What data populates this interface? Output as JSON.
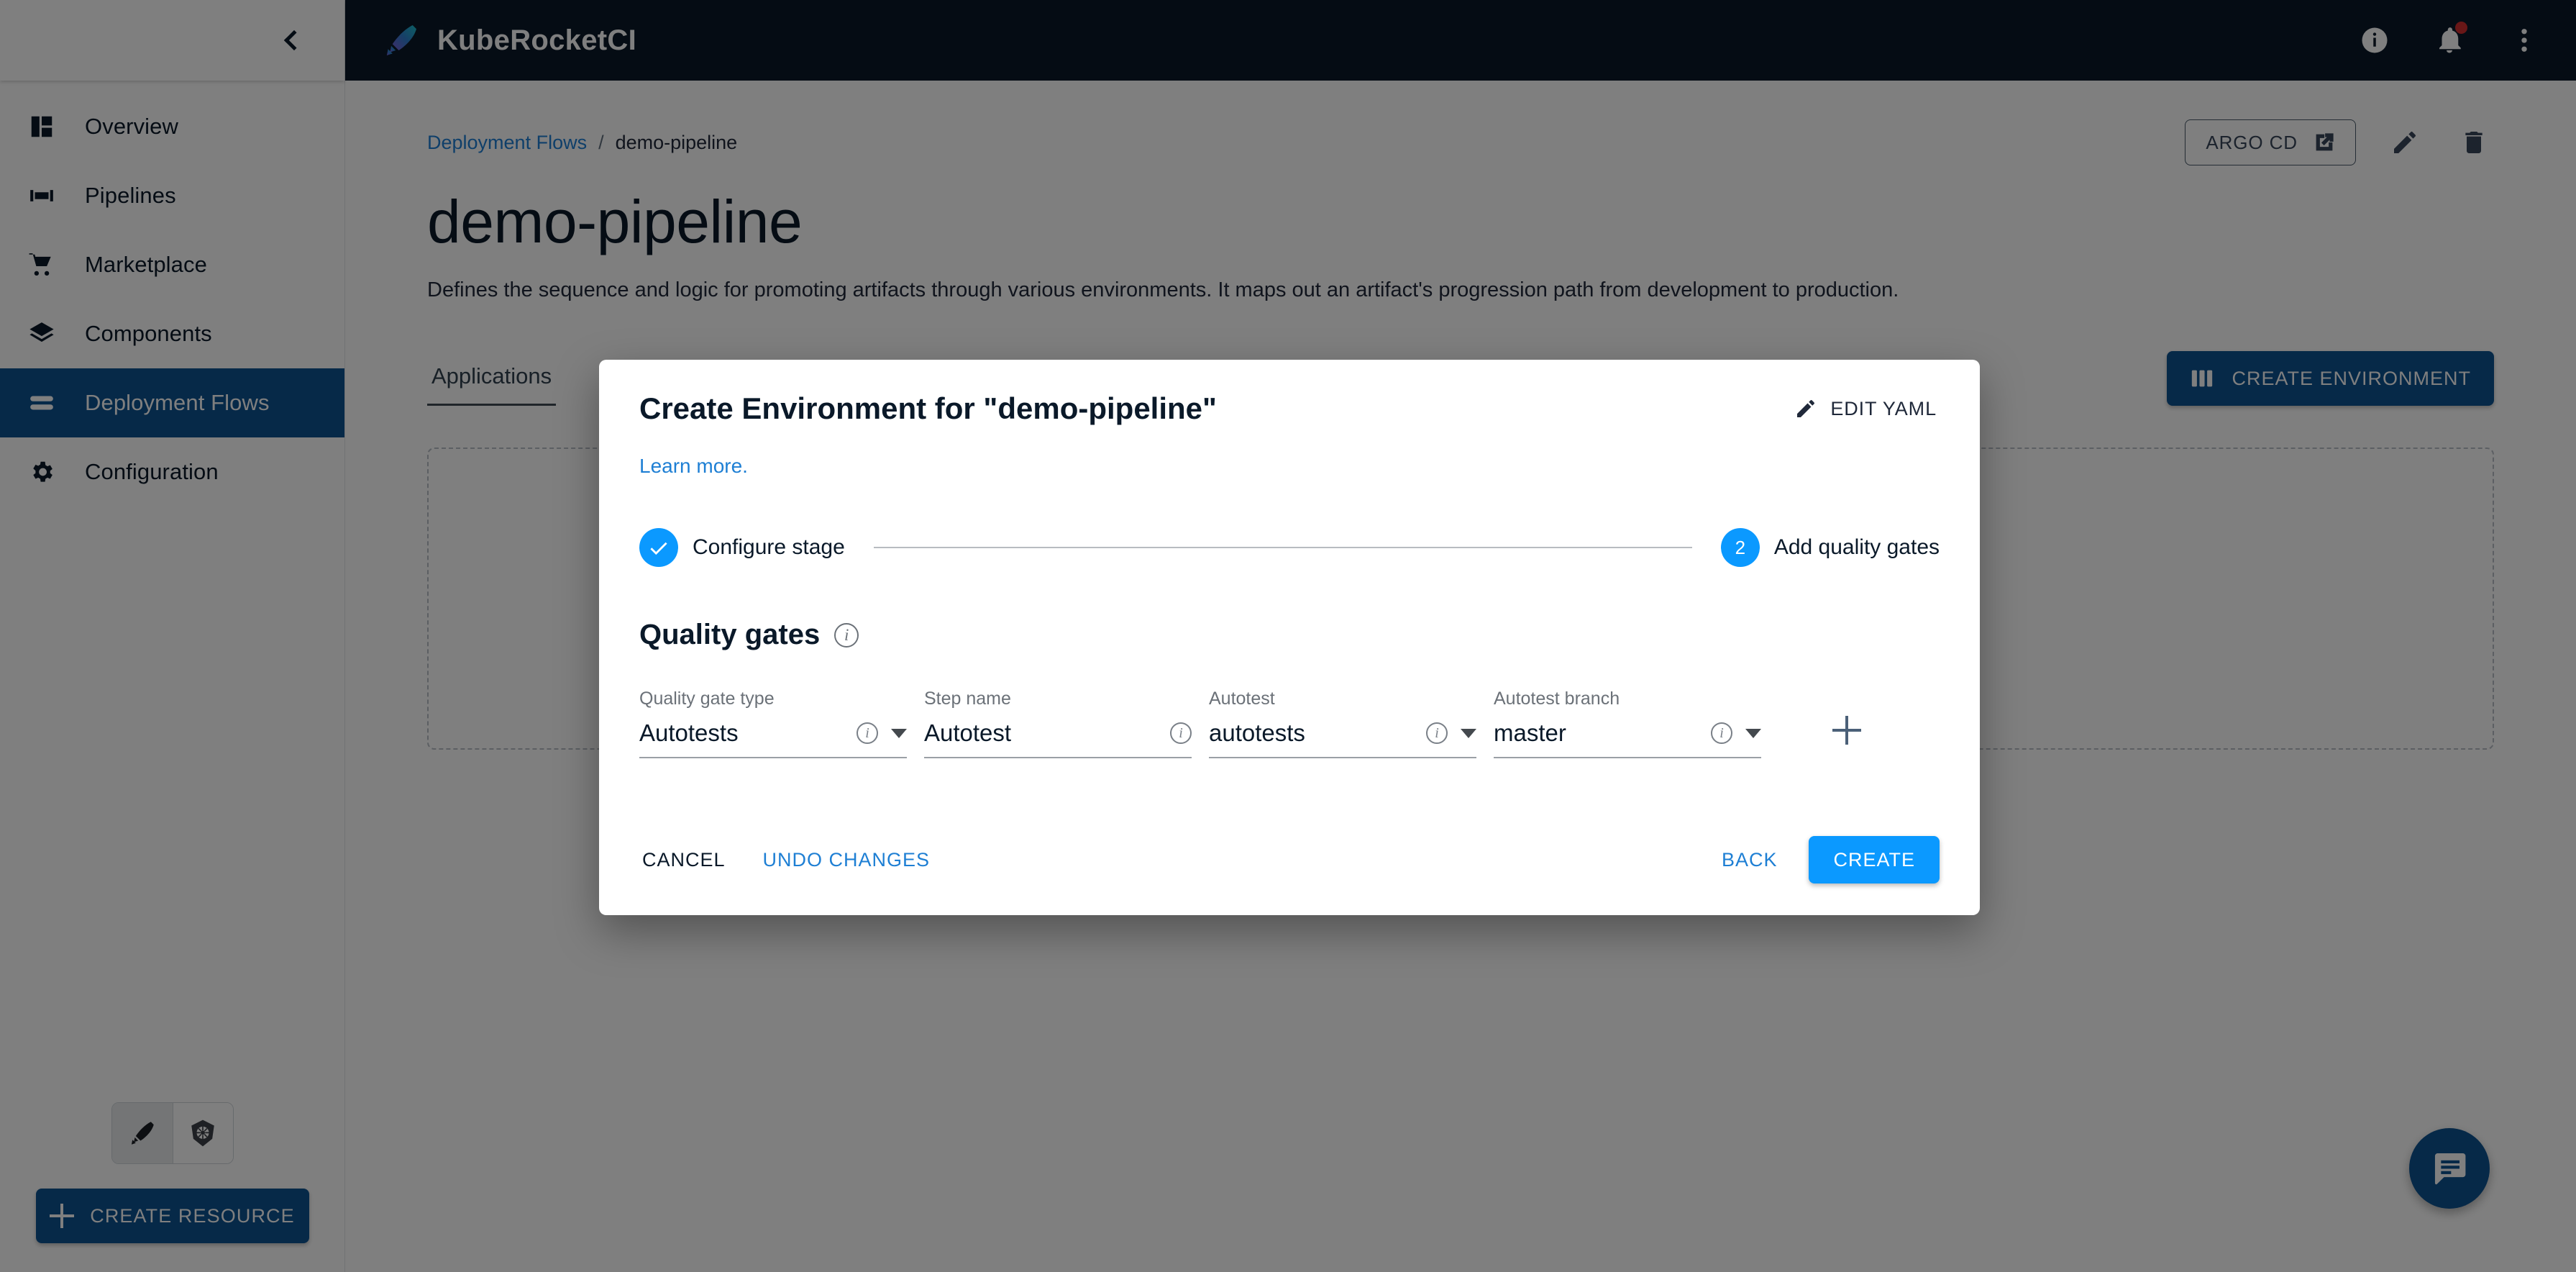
{
  "app": {
    "brand_name": "KubeRocketCI",
    "logo_icon": "rocket-feather-icon"
  },
  "topbar": {
    "info_icon": "info-icon",
    "notifications_icon": "bell-icon",
    "more_icon": "more-vertical-icon"
  },
  "sidebar": {
    "collapse_icon": "chevron-left-icon",
    "items": [
      {
        "label": "Overview",
        "icon": "dashboard-icon",
        "active": false
      },
      {
        "label": "Pipelines",
        "icon": "pipelines-icon",
        "active": false
      },
      {
        "label": "Marketplace",
        "icon": "cart-icon",
        "active": false
      },
      {
        "label": "Components",
        "icon": "layers-icon",
        "active": false
      },
      {
        "label": "Deployment Flows",
        "icon": "flows-icon",
        "active": true
      },
      {
        "label": "Configuration",
        "icon": "gear-icon",
        "active": false
      }
    ],
    "theme_toggle": [
      {
        "icon": "rocket-feather-icon",
        "selected": true
      },
      {
        "icon": "kubernetes-icon",
        "selected": false
      }
    ],
    "create_resource_label": "CREATE RESOURCE",
    "create_resource_icon": "plus-icon"
  },
  "page": {
    "breadcrumb": {
      "parent": "Deployment Flows",
      "separator": "/",
      "current": "demo-pipeline"
    },
    "title": "demo-pipeline",
    "description": "Defines the sequence and logic for promoting artifacts through various environments. It maps out an artifact's progression path from development to production.",
    "header_actions": {
      "argo_cd_label": "ARGO CD",
      "argo_cd_icon": "external-link-icon",
      "edit_icon": "pencil-icon",
      "delete_icon": "trash-icon"
    },
    "tabs": [
      {
        "label": "Applications",
        "active": true
      }
    ],
    "create_environment_label": "CREATE ENVIRONMENT",
    "create_environment_icon": "columns-icon"
  },
  "chat_fab": {
    "icon": "chat-bubble-icon"
  },
  "modal": {
    "title": "Create Environment for \"demo-pipeline\"",
    "edit_yaml_label": "EDIT YAML",
    "edit_yaml_icon": "pencil-icon",
    "learn_more_label": "Learn more.",
    "steps": [
      {
        "label": "Configure stage",
        "marker": "✓",
        "state": "complete",
        "icon": "check-icon"
      },
      {
        "label": "Add quality gates",
        "marker": "2",
        "state": "active"
      }
    ],
    "section": {
      "title": "Quality gates",
      "info_icon": "info-outline-icon"
    },
    "fields": [
      {
        "label": "Quality gate type",
        "value": "Autotests",
        "placeholder": "Quality gate type",
        "info_icon": "info-outline-icon",
        "has_dropdown": true
      },
      {
        "label": "Step name",
        "value": "Autotest",
        "placeholder": "Step name",
        "info_icon": "info-outline-icon",
        "has_dropdown": false
      },
      {
        "label": "Autotest",
        "value": "autotests",
        "placeholder": "Autotest",
        "info_icon": "info-outline-icon",
        "has_dropdown": true
      },
      {
        "label": "Autotest branch",
        "value": "master",
        "placeholder": "Autotest branch",
        "info_icon": "info-outline-icon",
        "has_dropdown": true
      }
    ],
    "add_gate_icon": "plus-icon",
    "footer": {
      "cancel_label": "CANCEL",
      "undo_label": "UNDO CHANGES",
      "back_label": "BACK",
      "create_label": "CREATE"
    }
  },
  "colors": {
    "brand_dark": "#0a1929",
    "primary_blue": "#0d5291",
    "accent_blue": "#0b99ff",
    "link_blue": "#1e7fd4",
    "badge_red": "#d32f2f"
  }
}
